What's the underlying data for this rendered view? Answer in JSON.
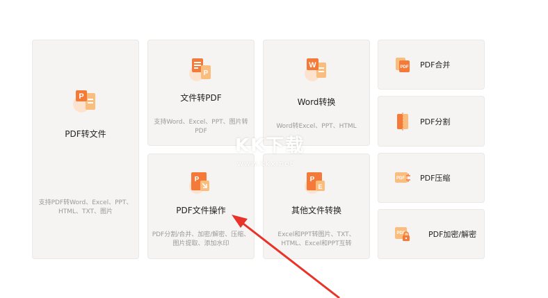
{
  "cards": {
    "pdf_to_file": {
      "title": "PDF转文件",
      "desc": "支持PDF转Word、Excel、PPT、HTML、TXT、图片"
    },
    "file_to_pdf": {
      "title": "文件转PDF",
      "desc": "支持Word、Excel、PPT、图片转PDF"
    },
    "word_convert": {
      "title": "Word转换",
      "desc": "Word转Excel、PPT、HTML"
    },
    "pdf_ops": {
      "title": "PDF文件操作",
      "desc": "PDF分割/合并、加密/解密、压缩、图片提取、添加水印"
    },
    "other_convert": {
      "title": "其他文件转换",
      "desc": "Excel和PPT转图片、TXT、HTML、Excel和PPT互转"
    }
  },
  "side": {
    "merge": "PDF合并",
    "split": "PDF分割",
    "compress": "PDF压缩",
    "encrypt": "PDF加密/解密"
  },
  "watermark": {
    "logo": "KK下载",
    "url": "www.kkx.net"
  },
  "colors": {
    "accent": "#f47a3a",
    "accent_light": "#fbbd7e",
    "card_bg": "#f5f4f2",
    "arrow": "#e8332a"
  },
  "icons": {
    "pdf_to_file": "pdf-convert-icon",
    "file_to_pdf": "file-to-pdf-icon",
    "word_convert": "word-icon",
    "pdf_ops": "pdf-operate-icon",
    "other_convert": "ppt-excel-icon",
    "merge": "pdf-merge-icon",
    "split": "pdf-split-icon",
    "compress": "pdf-compress-icon",
    "encrypt": "pdf-lock-icon"
  }
}
